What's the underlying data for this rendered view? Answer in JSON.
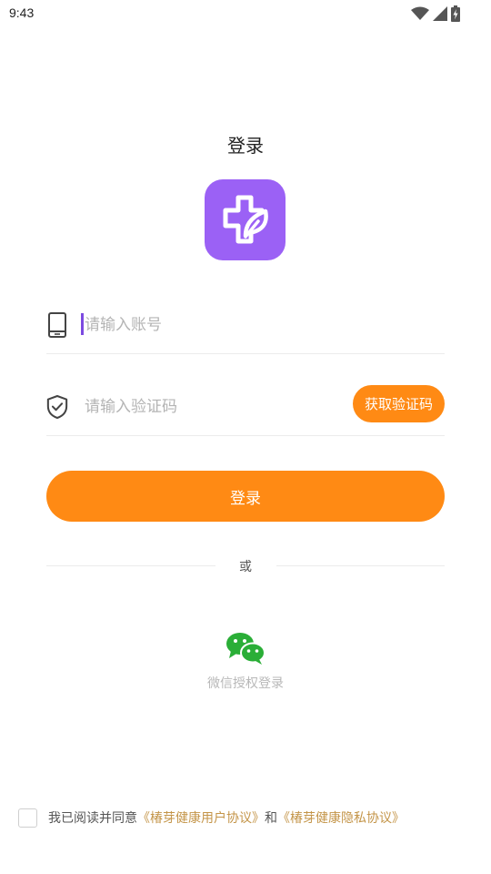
{
  "status_bar": {
    "time": "9:43"
  },
  "page": {
    "title": "登录"
  },
  "logo": {
    "icon": "medical-cross-leaf-icon",
    "color": "#9b61f5"
  },
  "phone_field": {
    "placeholder": "请输入账号",
    "value": ""
  },
  "code_field": {
    "placeholder": "请输入验证码",
    "value": "",
    "get_code_label": "获取验证码"
  },
  "login_button": {
    "label": "登录"
  },
  "divider": {
    "text": "或"
  },
  "wechat_login": {
    "label": "微信授权登录",
    "icon": "wechat-icon",
    "color": "#2aae37"
  },
  "agreement": {
    "checked": false,
    "prefix": "我已阅读并同意",
    "user_agreement": "《椿芽健康用户协议》",
    "conjunction": "和",
    "privacy_agreement": "《椿芽健康隐私协议》"
  },
  "colors": {
    "accent": "#ff8a14",
    "link": "#c49549",
    "placeholder": "#b4b4b4"
  }
}
